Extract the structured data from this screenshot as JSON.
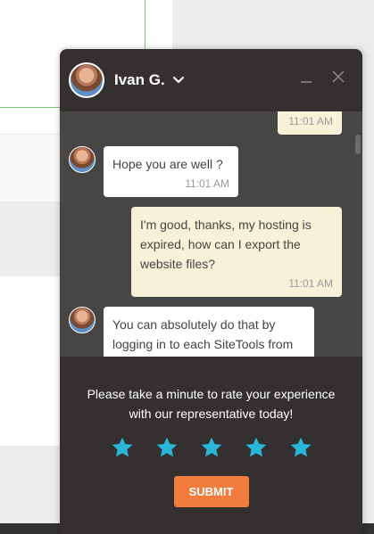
{
  "chat": {
    "agent_name": "Ivan G.",
    "messages": [
      {
        "from": "user",
        "text": "",
        "time": "11:01 AM"
      },
      {
        "from": "agent",
        "text": "Hope you are well ?",
        "time": "11:01 AM"
      },
      {
        "from": "user",
        "text": "I'm good, thanks, my hosting is expired, how can I export the website files?",
        "time": "11:01 AM"
      },
      {
        "from": "agent",
        "text": "You can absolutely do that by logging in to each SiteTools from",
        "time": ""
      }
    ]
  },
  "rating": {
    "prompt": "Please take a minute to rate your experience with our representative today!",
    "stars_total": 5,
    "star_color": "#29b6d8",
    "submit_label": "SUBMIT"
  },
  "colors": {
    "widget_bg": "#33302f",
    "messages_bg": "#484644",
    "agent_bubble": "#ffffff",
    "user_bubble": "#f7f1d8",
    "submit_button": "#f27b3e"
  },
  "icons": [
    "avatar",
    "chevron-down-icon",
    "minimize-icon",
    "close-icon",
    "star-icon"
  ]
}
